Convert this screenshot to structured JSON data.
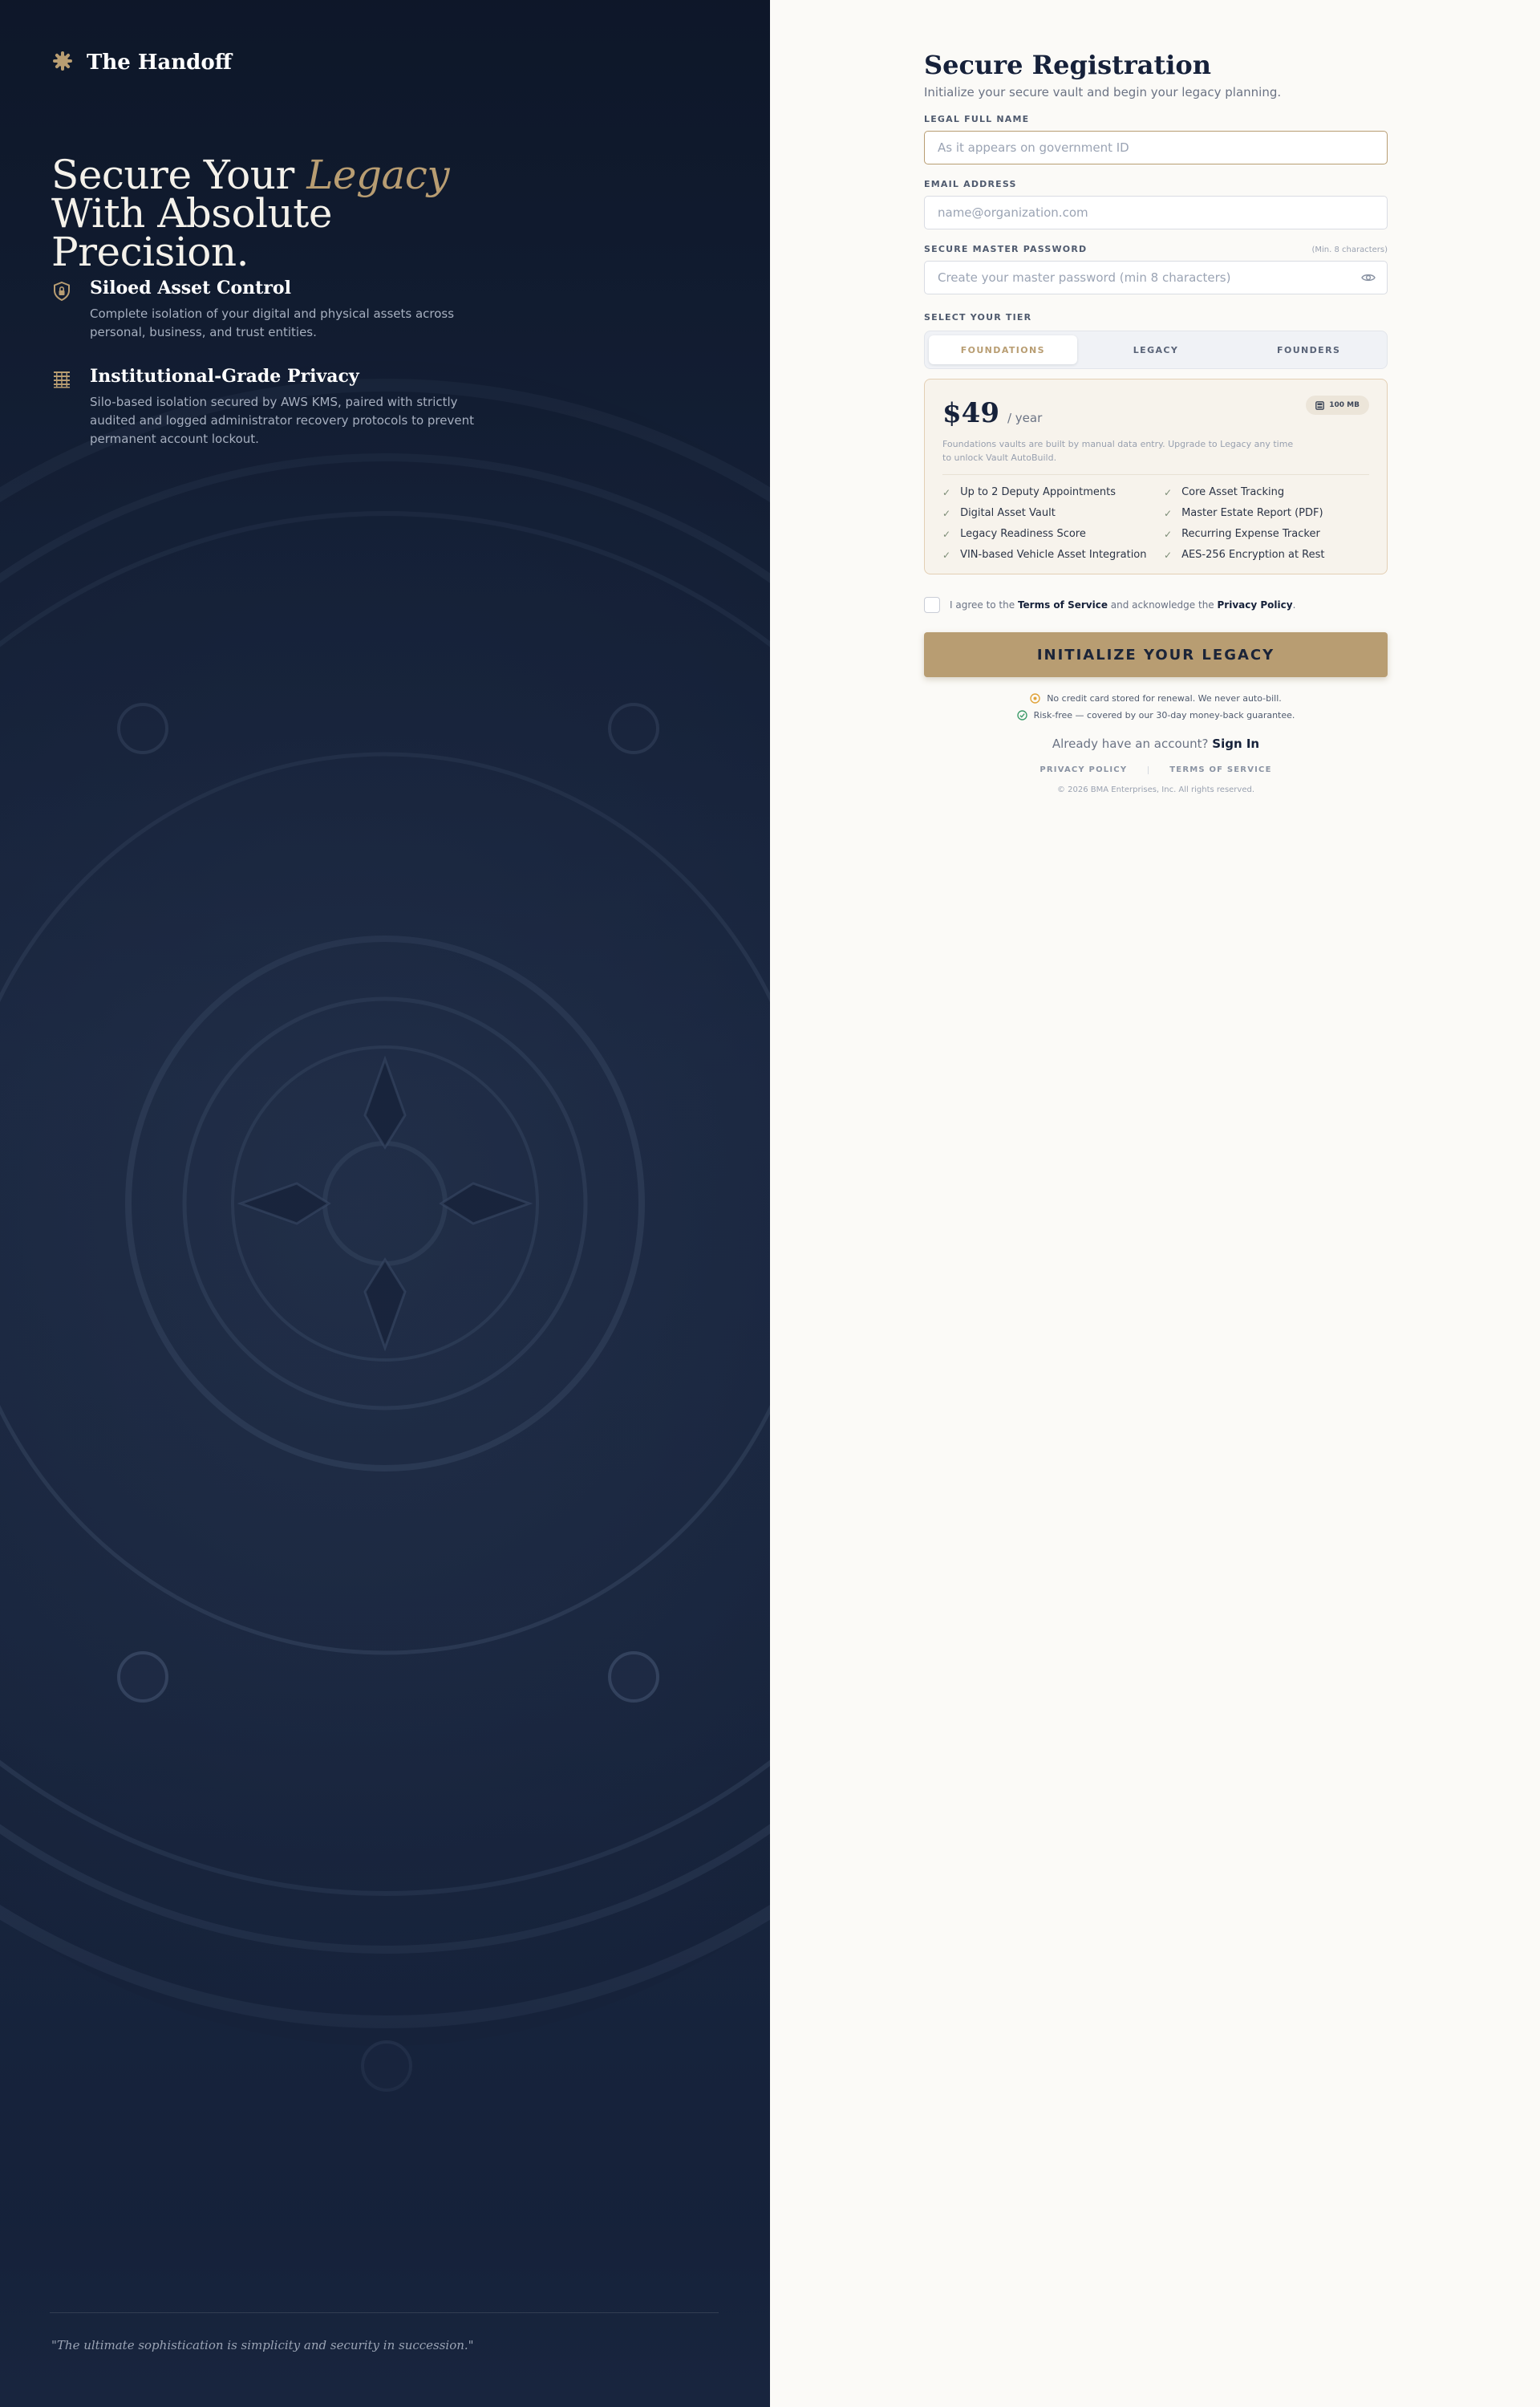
{
  "brand": {
    "name": "The Handoff",
    "icon": "gear-seal-icon"
  },
  "hero": {
    "line1_prefix": "Secure Your ",
    "line1_accent": "Legacy",
    "line2": "With Absolute",
    "line3": "Precision."
  },
  "features": [
    {
      "icon": "shield-lock-icon",
      "title": "Siloed Asset Control",
      "description": "Complete isolation of your digital and physical assets across personal, business, and trust entities."
    },
    {
      "icon": "grid-lock-icon",
      "title": "Institutional-Grade Privacy",
      "description": "Silo-based isolation secured by AWS KMS, paired with strictly audited and logged administrator recovery protocols to prevent permanent account lockout."
    }
  ],
  "quote": "\"The ultimate sophistication is simplicity and security in succession.\"",
  "form": {
    "title": "Secure Registration",
    "subtitle": "Initialize your secure vault and begin your legacy planning.",
    "full_name": {
      "label": "LEGAL FULL NAME",
      "placeholder": "As it appears on government ID"
    },
    "email": {
      "label": "EMAIL ADDRESS",
      "placeholder": "name@organization.com"
    },
    "password": {
      "label": "SECURE MASTER PASSWORD",
      "hint": "(Min. 8 characters)",
      "placeholder": "Create your master password (min 8 characters)",
      "toggle_icon": "eye-icon"
    },
    "tier_label": "SELECT YOUR TIER",
    "tiers": [
      "FOUNDATIONS",
      "LEGACY",
      "FOUNDERS"
    ],
    "selected_tier": "FOUNDATIONS"
  },
  "plan": {
    "price": "$49",
    "period": "/ year",
    "storage": "100 MB",
    "storage_icon": "storage-icon",
    "description": "Foundations vaults are built by manual data entry. Upgrade to Legacy any time to unlock Vault AutoBuild.",
    "features_left": [
      "Up to 2 Deputy Appointments",
      "Digital Asset Vault",
      "Legacy Readiness Score",
      "VIN-based Vehicle Asset Integration"
    ],
    "features_right": [
      "Core Asset Tracking",
      "Master Estate Report (PDF)",
      "Recurring Expense Tracker",
      "AES-256 Encryption at Rest"
    ]
  },
  "agreement": {
    "prefix": "I agree to the ",
    "terms": "Terms of Service",
    "middle": " and acknowledge the ",
    "privacy": "Privacy Policy",
    "suffix": "."
  },
  "cta": "INITIALIZE YOUR LEGACY",
  "notes": {
    "no_card": "No credit card stored for renewal. We never auto-bill.",
    "risk_free": "Risk-free — covered by our 30-day money-back guarantee."
  },
  "signin": {
    "prompt": "Already have an account? ",
    "link": "Sign In"
  },
  "footer": {
    "privacy": "PRIVACY POLICY",
    "terms": "TERMS OF SERVICE",
    "copyright": "© 2026 BMA Enterprises, Inc. All rights reserved."
  },
  "colors": {
    "navy": "#16213a",
    "gold": "#b89d72",
    "left_bg": "#1c2a45",
    "right_bg": "#fbfaf7"
  }
}
